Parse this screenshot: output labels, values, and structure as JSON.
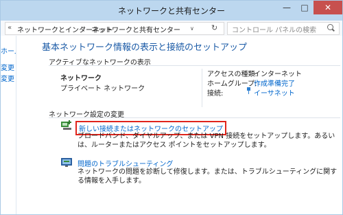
{
  "window": {
    "title": "ネットワークと共有センター",
    "minimize": "—",
    "maximize": "□",
    "close": "✕"
  },
  "address": {
    "chevron": "«",
    "crumbs": [
      "ネットワークとインターネット",
      "ネットワークと共有センター"
    ],
    "separator": "›",
    "dropdown": "∨",
    "refresh": "↻"
  },
  "search": {
    "placeholder": "コントロール パネルの検索"
  },
  "left_pane": {
    "items": [
      "ホーム",
      "変更",
      "変更"
    ]
  },
  "main": {
    "heading": "基本ネットワーク情報の表示と接続のセットアップ",
    "active_section": "アクティブなネットワークの表示",
    "network_name": "ネットワーク",
    "network_type": "プライベート ネットワーク",
    "props": [
      {
        "label": "アクセスの種類:",
        "value": "インターネット"
      },
      {
        "label": "ホームグループ:",
        "value": "作成準備完了"
      },
      {
        "label": "接続:",
        "value": "イーサネット"
      }
    ],
    "settings_section": "ネットワーク設定の変更",
    "tasks": [
      {
        "title": "新しい接続またはネットワークのセットアップ",
        "desc": "ブロードバンド、ダイヤルアップ、または VPN 接続をセットアップします。あるいは、ルーターまたはアクセス ポイントをセットアップします。"
      },
      {
        "title": "問題のトラブルシューティング",
        "desc": "ネットワークの問題を診断して修復します。または、トラブルシューティングに関する情報を入手します。"
      }
    ]
  },
  "colors": {
    "accent": "#0066cc",
    "highlight": "#e0241b",
    "titlebar": "#bcd7ef"
  }
}
